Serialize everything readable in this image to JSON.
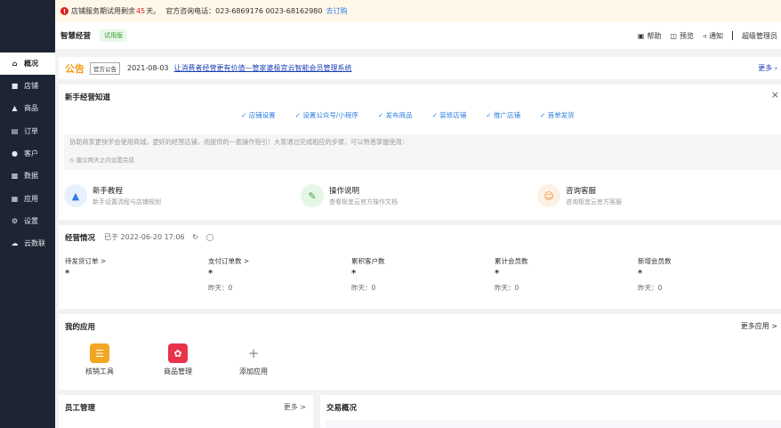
{
  "sidebar": {
    "items": [
      {
        "label": "概况",
        "icon": "home-icon"
      },
      {
        "label": "店铺",
        "icon": "store-icon"
      },
      {
        "label": "商品",
        "icon": "goods-icon"
      },
      {
        "label": "订单",
        "icon": "order-icon"
      },
      {
        "label": "客户",
        "icon": "customer-icon"
      },
      {
        "label": "数据",
        "icon": "data-icon"
      },
      {
        "label": "应用",
        "icon": "apps-icon"
      },
      {
        "label": "设置",
        "icon": "gear-icon"
      },
      {
        "label": "云数联",
        "icon": "cloud-icon"
      }
    ]
  },
  "notice_bar": {
    "prefix": "店铺服务期试用剩余",
    "days": "45",
    "suffix": "天。",
    "phone": "官方咨询电话：023-6869176 0023-68162980",
    "link": "去订购"
  },
  "topbar": {
    "title": "智慧经营",
    "badge": "试用版",
    "help": "帮助",
    "preview": "预览",
    "notify": "通知",
    "admin": "超级管理员"
  },
  "announcement": {
    "heading": "公告",
    "tag": "官方公告",
    "date": "2021-08-03",
    "link": "让消费者经营更有价值—管家婆极宜云智能会员管理系统",
    "more": "更多"
  },
  "guide": {
    "title": "新手经营知道",
    "steps": [
      "店铺设置",
      "设置公众号/小程序",
      "发布商品",
      "装修店铺",
      "推广店铺",
      "首单发货"
    ],
    "desc": "协助商家更快学会使用商城，更好的经营店铺，而提供的一套操作指引！大家通过完成相应的步骤，可以熟悉掌握使用：",
    "tip": "建议两天之内设置完成",
    "items": [
      {
        "title": "新手教程",
        "sub": "新手设置流程与店铺规划"
      },
      {
        "title": "操作说明",
        "sub": "查看极宜云官方操作文档"
      },
      {
        "title": "咨询客服",
        "sub": "咨询极宜云官方客服"
      }
    ]
  },
  "business": {
    "title": "经营情况",
    "updated": "已于 2022-06-20 17:06",
    "stats": [
      {
        "label": "待发货订单 >",
        "value": "*",
        "yesterday": ""
      },
      {
        "label": "支付订单数 >",
        "value": "*",
        "yesterday": "昨天：0"
      },
      {
        "label": "累积客户数",
        "value": "*",
        "yesterday": "昨天：0"
      },
      {
        "label": "累计会员数",
        "value": "*",
        "yesterday": "昨天：0"
      },
      {
        "label": "新增会员数",
        "value": "*",
        "yesterday": "昨天：0"
      }
    ]
  },
  "apps": {
    "title": "我的应用",
    "more": "更多应用 >",
    "items": [
      {
        "label": "核销工具"
      },
      {
        "label": "商品管理"
      },
      {
        "label": "添加应用"
      }
    ]
  },
  "staff": {
    "title": "员工管理",
    "more": "更多 >"
  },
  "trade": {
    "title": "交易概况"
  },
  "colors": {
    "sidebar": "#1d2433",
    "accent": "#2f7de1",
    "warning": "#e02020",
    "notice": "#f39b12"
  }
}
